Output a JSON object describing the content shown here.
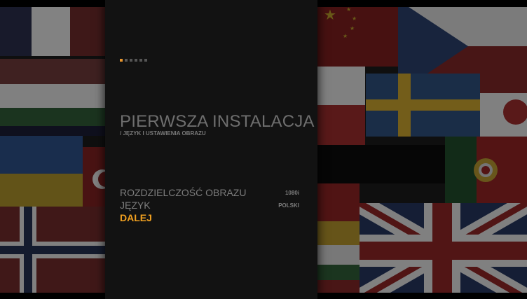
{
  "wizard": {
    "steps_total": 6,
    "current_step": 1,
    "title": "PIERWSZA INSTALACJA",
    "subtitle": "/ JĘZYK I USTAWIENIA OBRAZU",
    "accent_color": "#f0a020"
  },
  "menu": {
    "resolution": {
      "label": "ROZDZIELCZOŚĆ OBRAZU",
      "value": "1080i"
    },
    "language": {
      "label": "JĘZYK",
      "value": "POLSKI"
    },
    "next": {
      "label": "DALEJ"
    }
  },
  "background": {
    "description_icons": [
      "flag-norway-icon",
      "flag-ukraine-icon",
      "flag-china-icon",
      "flag-czech-icon",
      "flag-sweden-icon",
      "flag-poland-icon",
      "flag-japan-icon",
      "flag-portugal-icon",
      "flag-uk-icon",
      "flag-turkey-icon"
    ]
  }
}
